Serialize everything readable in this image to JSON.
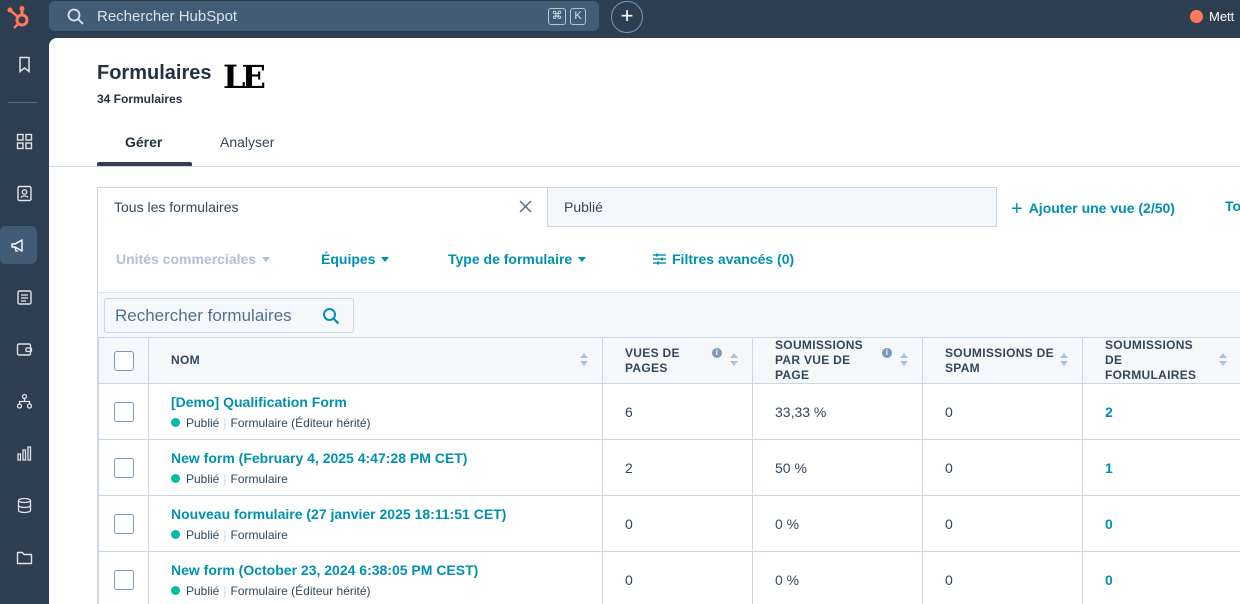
{
  "topbar": {
    "search_placeholder": "Rechercher HubSpot",
    "shortcut_cmd": "⌘",
    "shortcut_key": "K",
    "upgrade_label": "Mett"
  },
  "header": {
    "title": "Formulaires",
    "count": "34 Formulaires"
  },
  "tabs": [
    {
      "label": "Gérer",
      "active": true
    },
    {
      "label": "Analyser",
      "active": false
    }
  ],
  "views": {
    "items": [
      {
        "label": "Tous les formulaires"
      },
      {
        "label": "Publié"
      }
    ],
    "add_view": "Ajouter une vue (2/50)",
    "all_views": "To"
  },
  "filters": {
    "business_units": "Unités commerciales",
    "teams": "Équipes",
    "form_type": "Type de formulaire",
    "advanced": "Filtres avancés (0)"
  },
  "table": {
    "search_placeholder": "Rechercher formulaires",
    "columns": {
      "name": "NOM",
      "page_views": "VUES DE PAGES",
      "subs_per_view": "SOUMISSIONS PAR VUE DE PAGE",
      "spam": "SOUMISSIONS DE SPAM",
      "submissions": "SOUMISSIONS DE FORMULAIRES"
    },
    "rows": [
      {
        "name": "[Demo] Qualification Form",
        "status": "Publié",
        "type": "Formulaire (Éditeur hérité)",
        "views": "6",
        "rate": "33,33 %",
        "spam": "0",
        "subs": "2"
      },
      {
        "name": "New form (February 4, 2025 4:47:28 PM CET)",
        "status": "Publié",
        "type": "Formulaire",
        "views": "2",
        "rate": "50 %",
        "spam": "0",
        "subs": "1"
      },
      {
        "name": "Nouveau formulaire (27 janvier 2025 18:11:51 CET)",
        "status": "Publié",
        "type": "Formulaire",
        "views": "0",
        "rate": "0 %",
        "spam": "0",
        "subs": "0"
      },
      {
        "name": "New form (October 23, 2024 6:38:05 PM CEST)",
        "status": "Publié",
        "type": "Formulaire (Éditeur hérité)",
        "views": "0",
        "rate": "0 %",
        "spam": "0",
        "subs": "0"
      }
    ]
  },
  "colors": {
    "nav_bg": "#2d3e50",
    "link": "#0091ae",
    "status_published": "#00bda5",
    "brand_orange": "#ff7a59"
  }
}
